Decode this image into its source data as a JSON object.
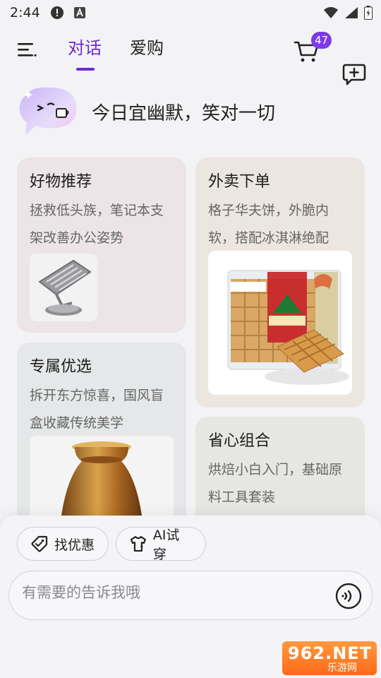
{
  "status_bar": {
    "time": "2:44"
  },
  "header": {
    "tabs": [
      {
        "label": "对话",
        "active": true
      },
      {
        "label": "爱购",
        "active": false
      }
    ],
    "cart_badge": "47"
  },
  "greeting": {
    "text": "今日宜幽默，笑对一切"
  },
  "cards": [
    {
      "title": "好物推荐",
      "desc": "拯救低头族，笔记本支架改善办公姿势"
    },
    {
      "title": "外卖下单",
      "desc": "格子华夫饼，外脆内软，搭配冰淇淋绝配"
    },
    {
      "title": "专属优选",
      "desc": "拆开东方惊喜，国风盲盒收藏传统美学"
    },
    {
      "title": "省心组合",
      "desc": "烘焙小白入门，基础原料工具套装"
    }
  ],
  "actions": {
    "deals_label": "找优惠",
    "try_on_label": "AI试穿"
  },
  "input": {
    "placeholder": "有需要的告诉我哦"
  },
  "watermark": {
    "main": "962.NET",
    "sub": "乐游网"
  },
  "colors": {
    "accent": "#6c2bd9",
    "badge": "#7c3aed"
  }
}
